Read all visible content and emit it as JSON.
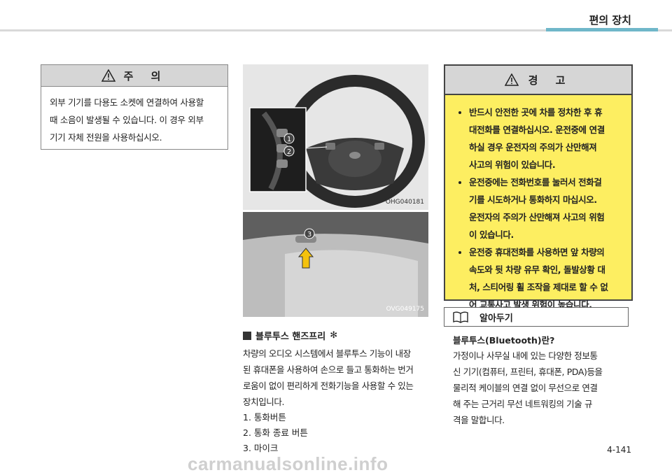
{
  "header": {
    "title": "편의 장치"
  },
  "caution": {
    "title": "주 의",
    "lines": [
      "외부 기기를 다용도 소켓에 연결하여 사용할",
      "때 소음이 발생될 수 있습니다. 이 경우 외부",
      "기기 자체 전원을 사용하십시오."
    ]
  },
  "images": [
    {
      "code": "OHG040181",
      "badges": [
        "1",
        "2"
      ]
    },
    {
      "code": "OVG049175",
      "badges": [
        "3"
      ]
    }
  ],
  "section": {
    "title": "블루투스 핸즈프리",
    "mark": "✻",
    "lines": [
      "차량의 오디오 시스템에서 블루투스 기능이 내장",
      "된 휴대폰을 사용하여 손으로 들고 통화하는 번거",
      "로움이 없이 편리하게 전화기능을 사용할 수 있는",
      "장치입니다."
    ],
    "list": [
      "1. 통화버튼",
      "2. 통화 종료 버튼",
      "3. 마이크"
    ]
  },
  "warning": {
    "title": "경 고",
    "items": [
      [
        "반드시 안전한 곳에 차를 정차한 후 휴",
        "대전화를 연결하십시오. 운전중에 연결",
        "하실 경우 운전자의 주의가 산만해져",
        "사고의 위험이 있습니다."
      ],
      [
        "운전중에는 전화번호를 눌러서 전화걸",
        "기를 시도하거나 통화하지 마십시오.",
        "운전자의 주의가 산만해져 사고의 위험",
        "이 있습니다."
      ],
      [
        "운전중 휴대전화를 사용하면 앞 차량의",
        "속도와 뒷 차량 유무 확인, 돌발상황 대",
        "처, 스티어링 휠 조작을 제대로 할 수 없",
        "어 교통사고 발생 위험이 높습니다."
      ]
    ]
  },
  "info": {
    "title": "알아두기",
    "subtitle": "블루투스(Bluetooth)란?",
    "lines": [
      "가정이나 사무실 내에 있는 다양한 정보통",
      "신 기기(컴퓨터, 프린터, 휴대폰, PDA)등을",
      "물리적 케이블의 연결 없이 무선으로 연결",
      "해 주는 근거리 무선 네트워킹의 기술 규",
      "격을 말합니다."
    ]
  },
  "page_number": "4-141",
  "watermark": "carmanualsonline.info",
  "colors": {
    "warning_bg": "#fdee61",
    "accent_line": "#6fb7c9",
    "head_gray": "#d6d6d6"
  }
}
